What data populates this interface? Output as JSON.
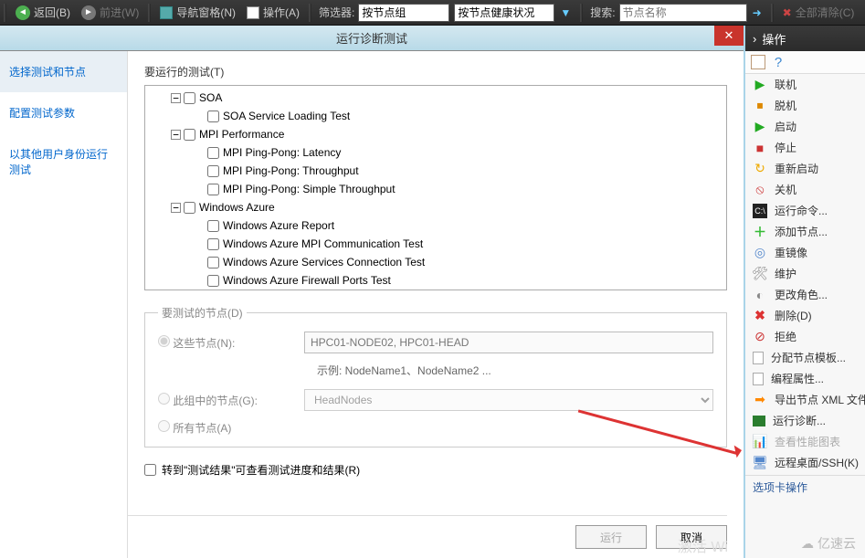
{
  "toolbar": {
    "back": "返回(B)",
    "forward": "前进(W)",
    "nav_panes": "导航窗格(N)",
    "actions": "操作(A)",
    "filter_label": "筛选器:",
    "filter1_value": "按节点组",
    "filter2_value": "按节点健康状况",
    "search_label": "搜索:",
    "search_placeholder": "节点名称",
    "clear_all": "全部清除(C)"
  },
  "dialog": {
    "title": "运行诊断测试",
    "step_select": "选择测试和节点",
    "step_config": "配置测试参数",
    "step_runas": "以其他用户身份运行测试",
    "tests_label": "要运行的测试(T)",
    "tree": {
      "soa": "SOA",
      "soa_svc": "SOA Service Loading Test",
      "mpi": "MPI Performance",
      "mpi_lat": "MPI Ping-Pong: Latency",
      "mpi_thr": "MPI Ping-Pong: Throughput",
      "mpi_simp": "MPI Ping-Pong: Simple Throughput",
      "azure": "Windows Azure",
      "az_rep": "Windows Azure Report",
      "az_mpi": "Windows Azure MPI Communication Test",
      "az_svc": "Windows Azure Services Connection Test",
      "az_fw": "Windows Azure Firewall Ports Test"
    },
    "nodes_label": "要测试的节点(D)",
    "radio_these": "这些节点(N):",
    "nodes_value": "HPC01-NODE02, HPC01-HEAD",
    "example": "示例: NodeName1、NodeName2 ...",
    "radio_group": "此组中的节点(G):",
    "group_value": "HeadNodes",
    "radio_all": "所有节点(A)",
    "goto_results": "转到\"测试结果\"可查看测试进度和结果(R)",
    "btn_run": "运行",
    "btn_cancel": "取消"
  },
  "actions": {
    "header": "操作",
    "items": {
      "online": "联机",
      "offline": "脱机",
      "start": "启动",
      "stop": "停止",
      "restart": "重新启动",
      "shutdown": "关机",
      "runcmd": "运行命令...",
      "addnode": "添加节点...",
      "reimage": "重镜像",
      "maint": "维护",
      "changerole": "更改角色...",
      "delete": "删除(D)",
      "reject": "拒绝",
      "assigntpl": "分配节点模板...",
      "editprops": "编程属性...",
      "exportxml": "导出节点 XML 文件...",
      "rundiag": "运行诊断...",
      "perfcharts": "查看性能图表",
      "remote": "远程桌面/SSH(K)"
    },
    "tab_section": "选项卡操作"
  },
  "watermark": {
    "w2": "亿速云"
  }
}
